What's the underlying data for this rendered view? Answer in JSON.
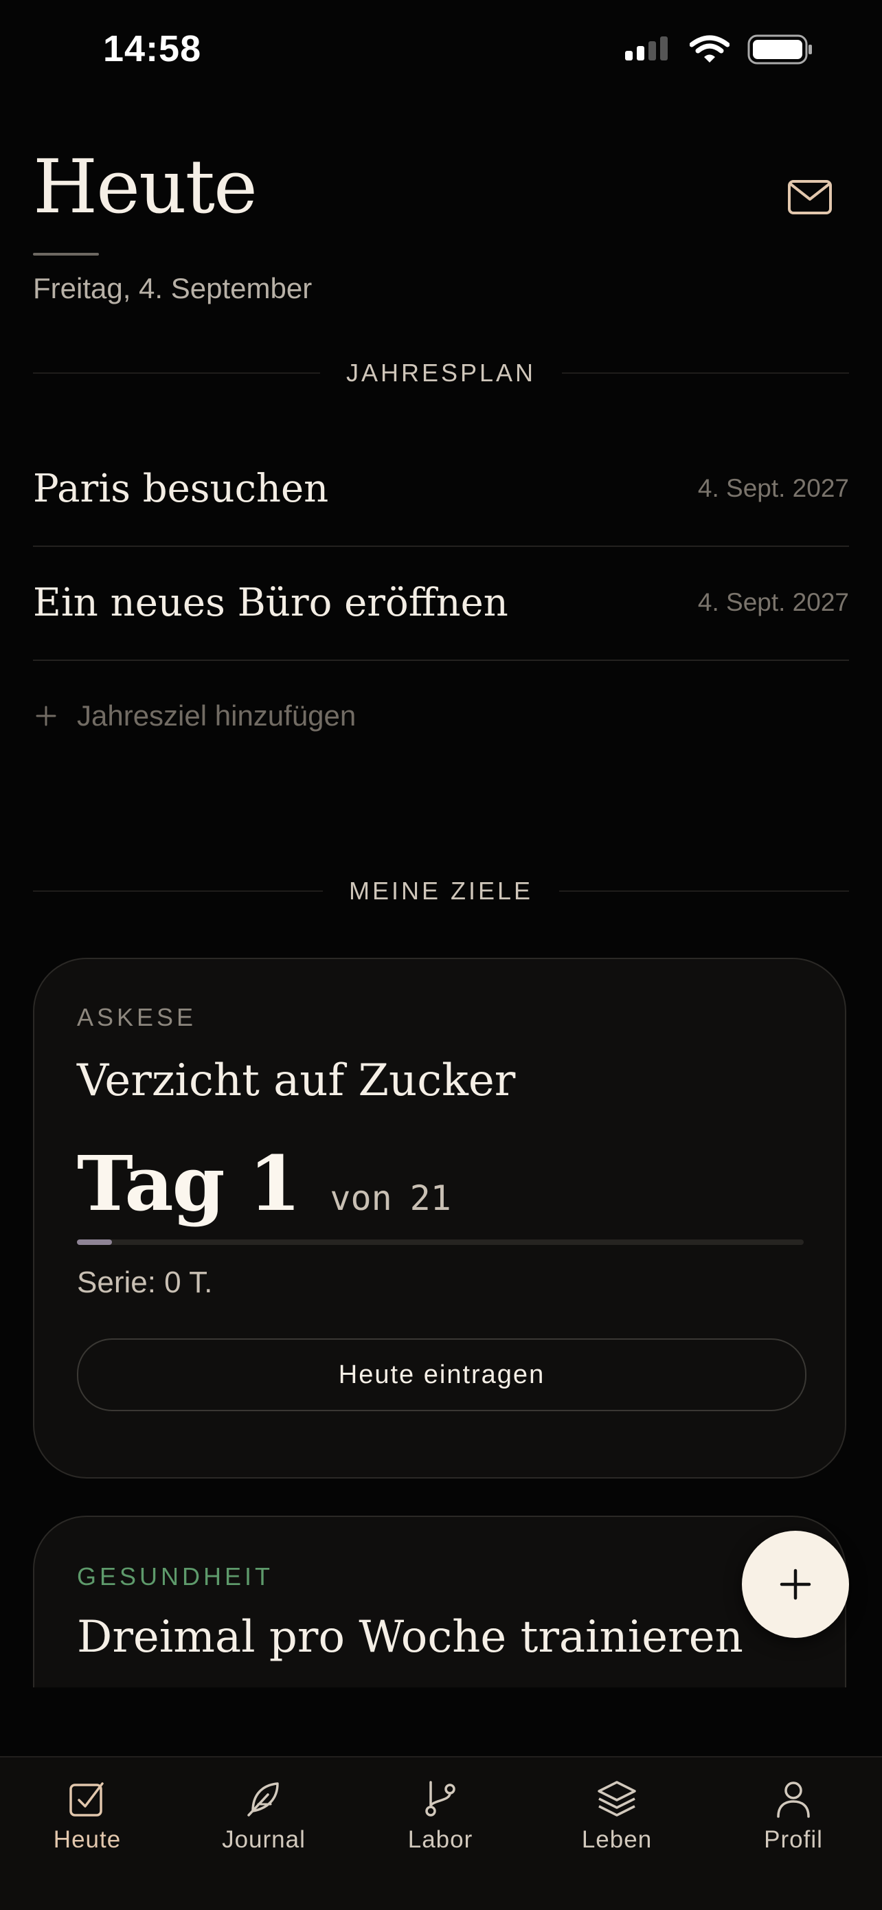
{
  "status_bar": {
    "time": "14:58",
    "icons": [
      "signal-icon",
      "wifi-icon",
      "battery-icon"
    ]
  },
  "header": {
    "title": "Heute",
    "date": "Freitag, 4. September",
    "mail_icon": "mail-icon"
  },
  "year_plan": {
    "heading": "JAHRESPLAN",
    "items": [
      {
        "name": "Paris besuchen",
        "date": "4. Sept. 2027"
      },
      {
        "name": "Ein neues Büro eröffnen",
        "date": "4. Sept. 2027"
      }
    ],
    "add_label": "Jahresziel hinzufügen"
  },
  "goals": {
    "heading": "MEINE ZIELE",
    "cards": [
      {
        "category": "ASKESE",
        "title": "Verzicht auf Zucker",
        "day_label": "Tag 1",
        "of_label": "von",
        "total": "21",
        "progress": 0.048,
        "streak": "Serie: 0 T.",
        "button": "Heute eintragen"
      },
      {
        "category": "GESUNDHEIT",
        "title": "Dreimal pro Woche trainieren",
        "category_color": "#5e9a6b"
      }
    ]
  },
  "fab": {
    "icon": "plus-icon"
  },
  "nav": {
    "items": [
      {
        "label": "Heute",
        "icon": "checkbox-icon",
        "active": true
      },
      {
        "label": "Journal",
        "icon": "feather-icon"
      },
      {
        "label": "Labor",
        "icon": "branch-icon"
      },
      {
        "label": "Leben",
        "icon": "layers-icon"
      },
      {
        "label": "Profil",
        "icon": "user-icon"
      }
    ]
  },
  "colors": {
    "accent": "#e2c7ad",
    "background": "#050505",
    "card": "#0f0e0d",
    "progress_fill": "#8e8395"
  }
}
